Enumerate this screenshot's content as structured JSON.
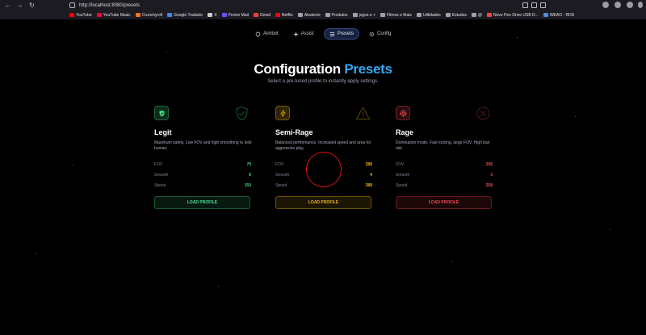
{
  "browser": {
    "url": "http://localhost:8080/presets",
    "bookmarks": [
      {
        "label": "YouTube",
        "color": "#ff0000"
      },
      {
        "label": "YouTube Music",
        "color": "#ff0033"
      },
      {
        "label": "Crunchyroll",
        "color": "#f47521"
      },
      {
        "label": "Google Tradutor",
        "color": "#4285f4"
      },
      {
        "label": "X",
        "color": "#cccccc"
      },
      {
        "label": "Proton Mail",
        "color": "#6d4aff"
      },
      {
        "label": "Gmail",
        "color": "#ea4335"
      },
      {
        "label": "Netflix",
        "color": "#e50914"
      },
      {
        "label": "Aleatorio",
        "color": "#a0a0a8"
      },
      {
        "label": "Produtos",
        "color": "#a0a0a8"
      },
      {
        "label": "jogos e +",
        "color": "#a0a0a8"
      },
      {
        "label": "Filmes e Mais",
        "color": "#a0a0a8"
      },
      {
        "label": "Utilidades",
        "color": "#a0a0a8"
      },
      {
        "label": "Estudos",
        "color": "#a0a0a8"
      },
      {
        "label": "@",
        "color": "#a0a0a8"
      },
      {
        "label": "Novo Pen Drive USB D...",
        "color": "#ee4444"
      },
      {
        "label": "WEAO - RDD",
        "color": "#5a8bd6"
      }
    ]
  },
  "nav": {
    "tabs": [
      {
        "label": "Aimbot",
        "icon": "crosshair-icon"
      },
      {
        "label": "Assist",
        "icon": "sparkle-icon"
      },
      {
        "label": "Presets",
        "icon": "sliders-icon"
      },
      {
        "label": "Config",
        "icon": "gear-icon"
      }
    ],
    "active": "Presets"
  },
  "header": {
    "title_main": "Configuration",
    "title_accent": "Presets",
    "subtitle": "Select a pre-tuned profile to instantly apply settings."
  },
  "presets": [
    {
      "name": "Legit",
      "icon": "shield-icon",
      "description": "Maximum safety. Low FOV and high smoothing to look human.",
      "stats": [
        {
          "label": "FOV",
          "value": "70"
        },
        {
          "label": "Smooth",
          "value": "6"
        },
        {
          "label": "Speed",
          "value": "150"
        }
      ],
      "button": "LOAD PROFILE",
      "color": "#3ddc84"
    },
    {
      "name": "Semi-Rage",
      "icon": "lightning-icon",
      "description": "Balanced performance. Increased speed and area for aggressive play.",
      "stats": [
        {
          "label": "FOV",
          "value": "388"
        },
        {
          "label": "Smooth",
          "value": "4"
        },
        {
          "label": "Speed",
          "value": "388"
        }
      ],
      "button": "LOAD PROFILE",
      "color": "#f5b400"
    },
    {
      "name": "Rage",
      "icon": "target-icon",
      "description": "Domination mode. Fast locking, large FOV. High ban risk.",
      "stats": [
        {
          "label": "FOV",
          "value": "206"
        },
        {
          "label": "Smooth",
          "value": "3"
        },
        {
          "label": "Speed",
          "value": "258"
        }
      ],
      "button": "LOAD PROFILE",
      "color": "#ef4d56"
    }
  ]
}
